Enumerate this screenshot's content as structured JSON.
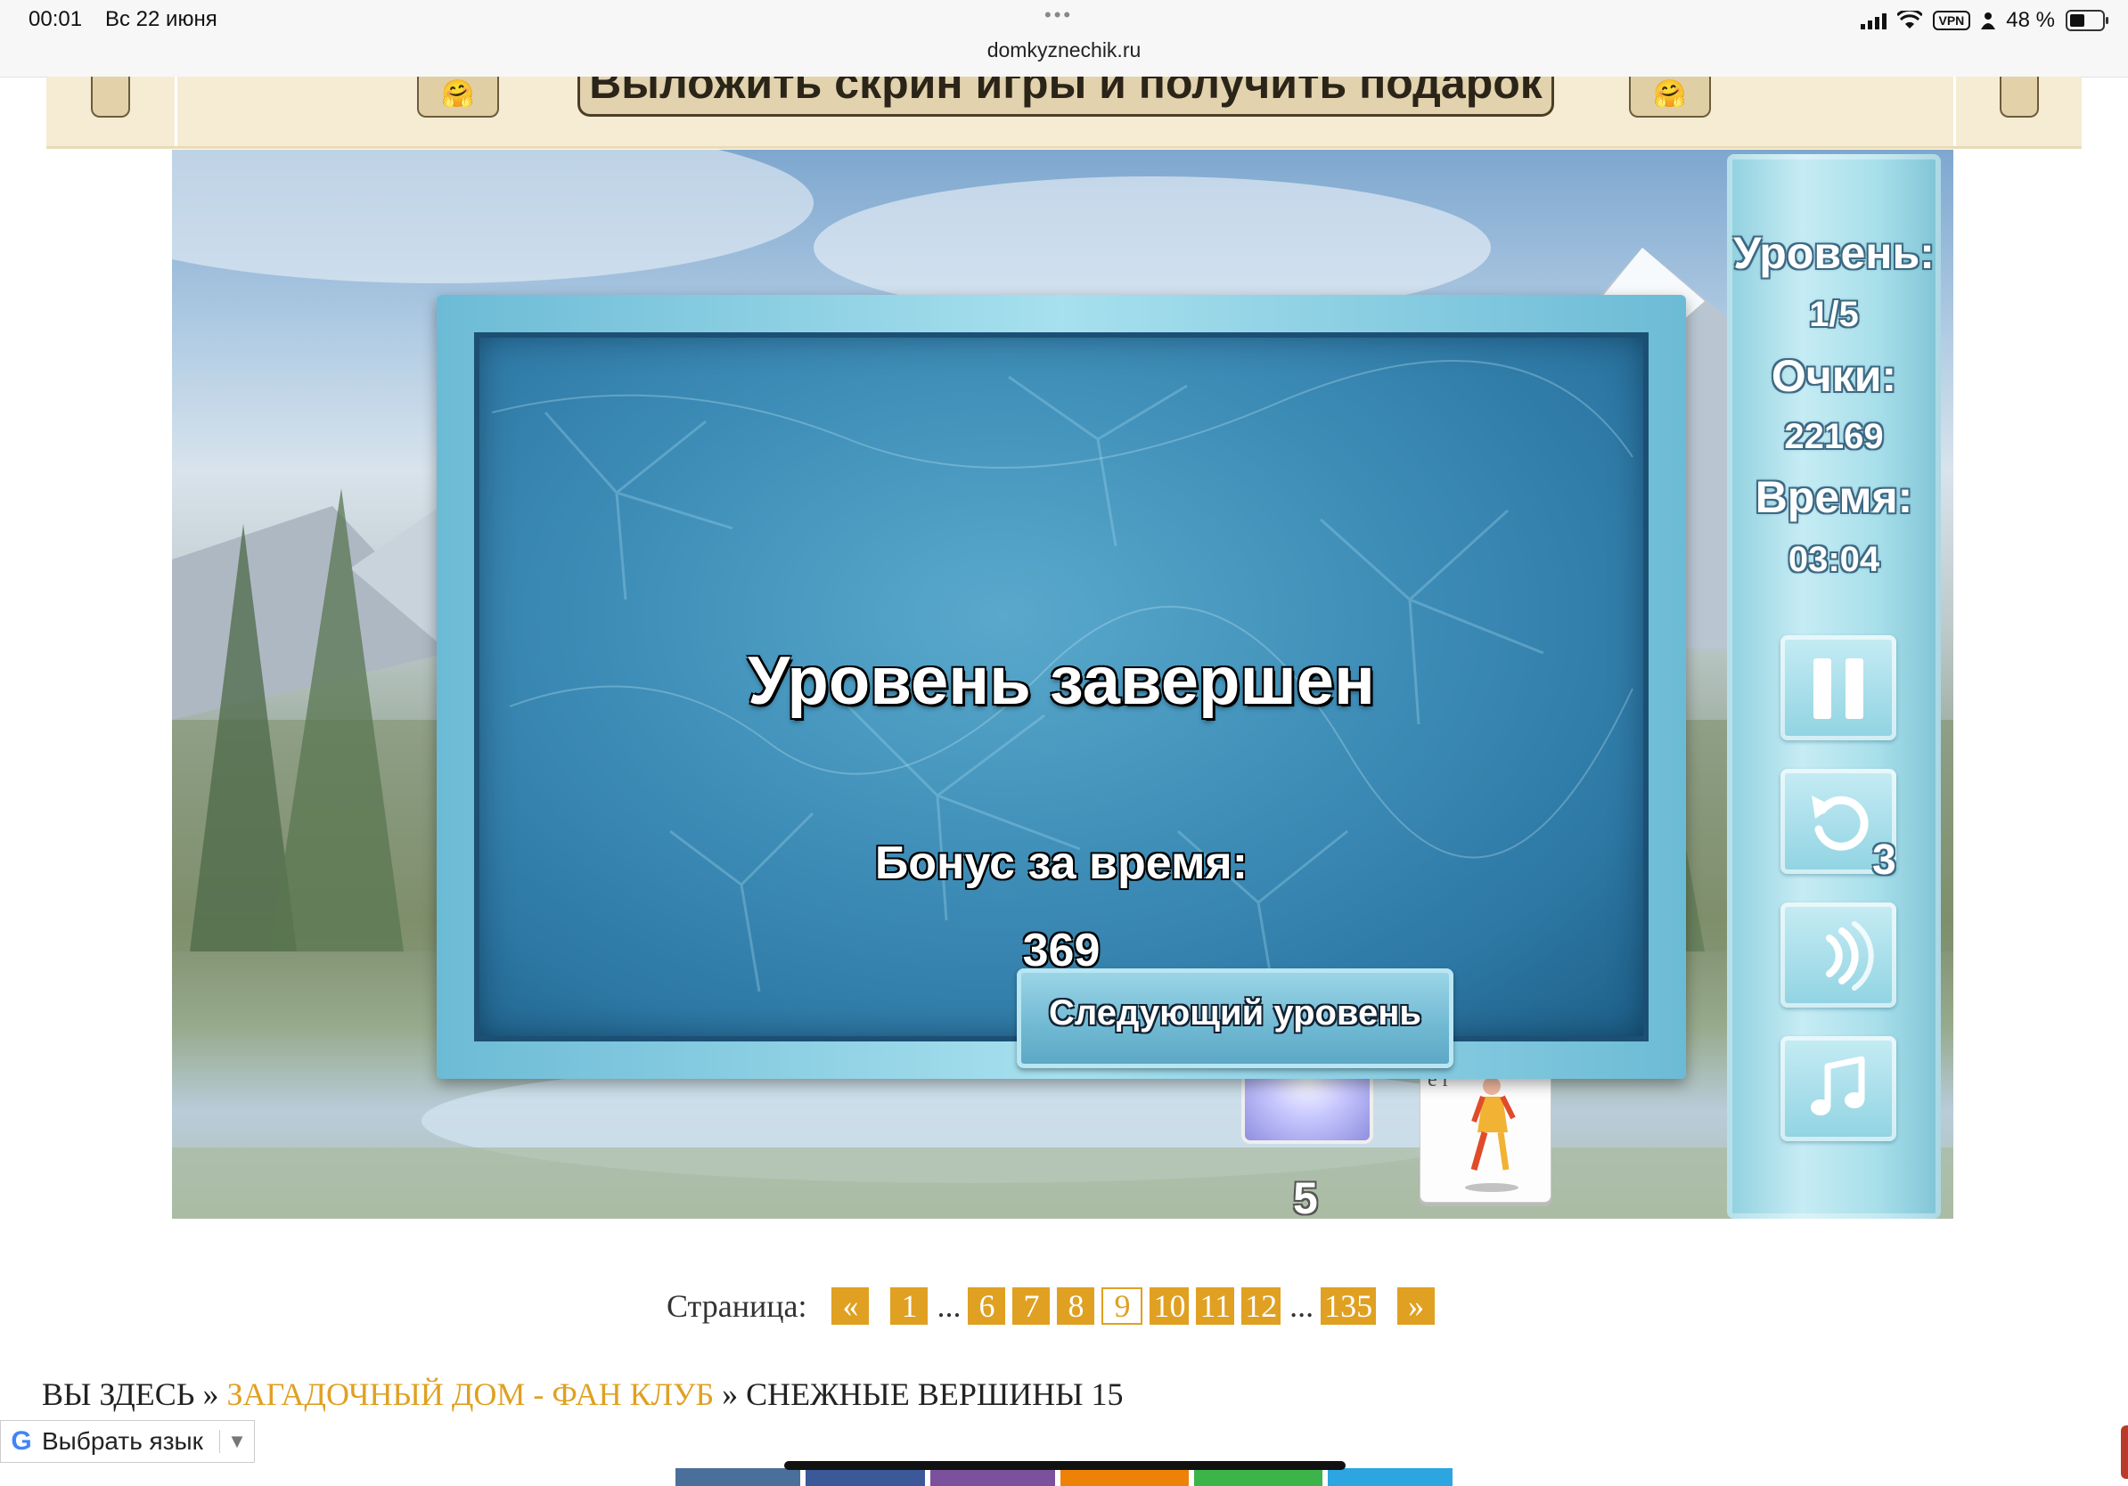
{
  "status_bar": {
    "time": "00:01",
    "date": "Вс 22 июня",
    "url": "domkyznechik.ru",
    "vpn": "VPN",
    "battery": "48 %"
  },
  "banner": {
    "text": "Выложить скрин игры и получить подарок",
    "emoji": "🤗"
  },
  "sidebar": {
    "level_label": "Уровень:",
    "level_value": "1/5",
    "score_label": "Очки:",
    "score_value": "22169",
    "time_label": "Время:",
    "time_value": "03:04",
    "retry_count": "3",
    "icons": [
      "pause-icon",
      "restart-icon",
      "sound-icon",
      "music-icon"
    ]
  },
  "board": {
    "stack_count": "5",
    "card_text": "e r"
  },
  "dialog": {
    "title": "Уровень завершен",
    "bonus_label": "Бонус за время:",
    "bonus_value": "369",
    "next_button": "Следующий уровень"
  },
  "pagination": {
    "label": "Страница:",
    "prev": "«",
    "next": "»",
    "ellipsis": "...",
    "pages": [
      "1",
      "6",
      "7",
      "8",
      "9",
      "10",
      "11",
      "12",
      "135"
    ],
    "current": "9"
  },
  "breadcrumb": {
    "here": "ВЫ ЗДЕСЬ",
    "sep": "»",
    "link": "ЗАГАДОЧНЫЙ ДОМ - ФАН КЛУБ",
    "current": "СНЕЖНЫЕ ВЕРШИНЫ 15"
  },
  "translate": {
    "logo": "G",
    "label": "Выбрать язык",
    "arrow": "▼"
  },
  "colors": {
    "accent": "#e0a021",
    "ice": "#6cbbd6",
    "banner_bg": "#f5ecd3"
  }
}
